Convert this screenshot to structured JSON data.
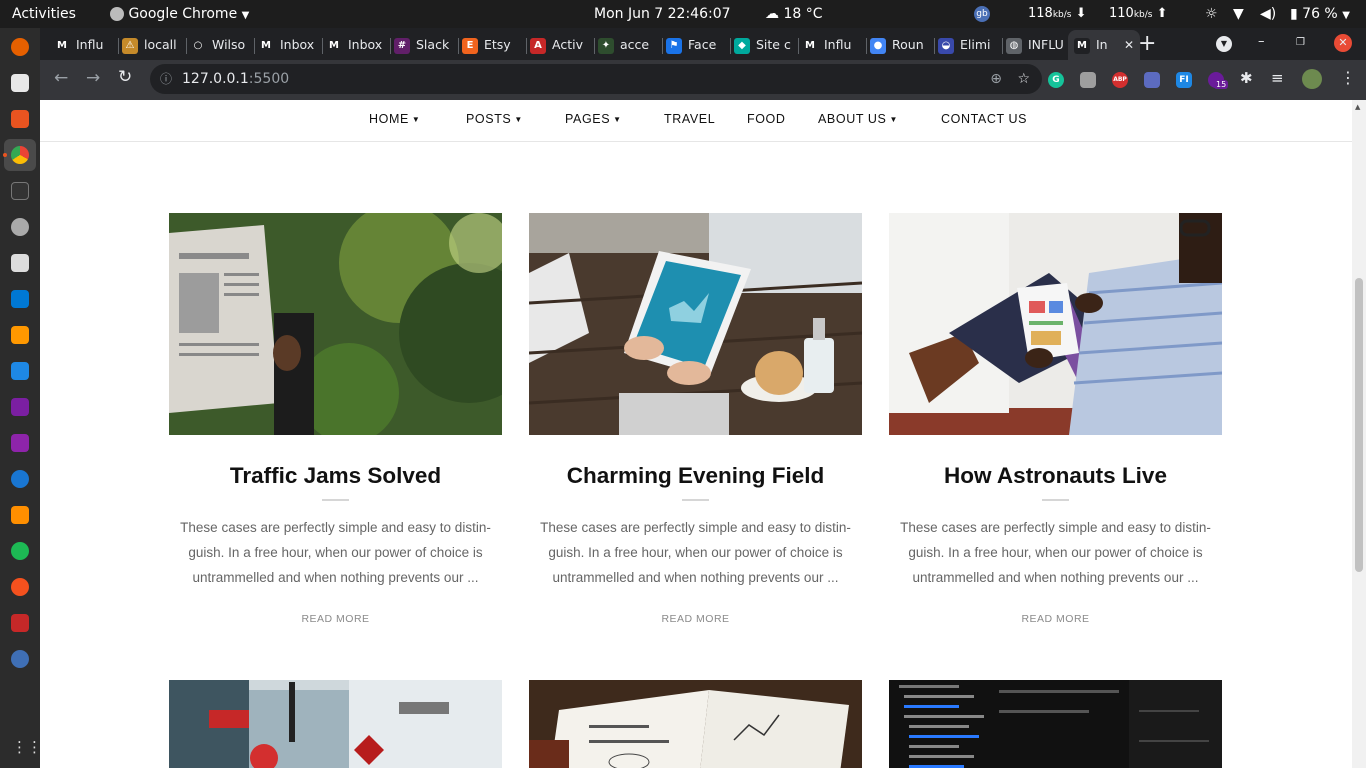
{
  "system": {
    "activities": "Activities",
    "app_name": "Google Chrome",
    "clock": "Mon Jun 7  22:46:07",
    "weather": "18 °C",
    "user_badge": "gb",
    "net_down": "118",
    "net_up": "110",
    "net_unit": "kb/s",
    "battery": "76 %"
  },
  "browser": {
    "tabs": [
      {
        "label": "Influ",
        "icon": "medium-icon",
        "color": "#202124",
        "glyph": "M"
      },
      {
        "label": "locall",
        "icon": "warning-icon",
        "color": "#c58a2a",
        "glyph": "⚠"
      },
      {
        "label": "Wilso",
        "icon": "github-icon",
        "color": "#202124",
        "glyph": "○"
      },
      {
        "label": "Inbox",
        "icon": "gmail-icon",
        "color": "#202124",
        "glyph": "M"
      },
      {
        "label": "Inbox",
        "icon": "gmail-icon",
        "color": "#202124",
        "glyph": "M"
      },
      {
        "label": "Slack",
        "icon": "slack-icon",
        "color": "#611f69",
        "glyph": "#"
      },
      {
        "label": "Etsy",
        "icon": "etsy-icon",
        "color": "#f1641e",
        "glyph": "E"
      },
      {
        "label": "Activ",
        "icon": "activity-icon",
        "color": "#c62828",
        "glyph": "A"
      },
      {
        "label": "acce",
        "icon": "leaf-icon",
        "color": "#2e4d2e",
        "glyph": "✦"
      },
      {
        "label": "Face",
        "icon": "flag-icon",
        "color": "#1a73e8",
        "glyph": "⚑"
      },
      {
        "label": "Site c",
        "icon": "diamond-icon",
        "color": "#00a99d",
        "glyph": "◆"
      },
      {
        "label": "Influ",
        "icon": "medium-icon",
        "color": "#202124",
        "glyph": "M"
      },
      {
        "label": "Roun",
        "icon": "round-icon",
        "color": "#4285f4",
        "glyph": "●"
      },
      {
        "label": "Elimi",
        "icon": "eliminate-icon",
        "color": "#3949ab",
        "glyph": "◒"
      },
      {
        "label": "INFLU",
        "icon": "globe-icon",
        "color": "#5f6368",
        "glyph": "◍"
      },
      {
        "label": "In",
        "icon": "medium-icon",
        "color": "#202124",
        "glyph": "M"
      }
    ],
    "url_host": "127.0.0.1",
    "url_port": ":5500",
    "ext_badge": "15",
    "ext_abp": "ABP",
    "ext_fi": "FI"
  },
  "nav": {
    "home": "HOME",
    "posts": "POSTS",
    "pages": "PAGES",
    "travel": "TRAVEL",
    "food": "FOOD",
    "about": "ABOUT US",
    "contact": "CONTACT US"
  },
  "posts": [
    {
      "title": "Traffic Jams Solved",
      "excerpt": "These cases are perfectly simple and easy to distin-guish. In a free hour, when our power of choice is untrammelled and when nothing prevents our ...",
      "read_more": "READ MORE"
    },
    {
      "title": "Charming Evening Field",
      "excerpt": "These cases are perfectly simple and easy to distin-guish. In a free hour, when our power of choice is untrammelled and when nothing prevents our ...",
      "read_more": "READ MORE"
    },
    {
      "title": "How Astronauts Live",
      "excerpt": "These cases are perfectly simple and easy to distin-guish. In a free hour, when our power of choice is untrammelled and when nothing prevents our ...",
      "read_more": "READ MORE"
    }
  ],
  "colors": {
    "topbar": "#1d1d1d",
    "dock": "#2c2c2c",
    "accent": "#e95420",
    "chrome_tabstrip": "#202124",
    "chrome_toolbar": "#35363a",
    "page_bg": "#ffffff",
    "heading": "#111111",
    "body_text": "#666666"
  }
}
